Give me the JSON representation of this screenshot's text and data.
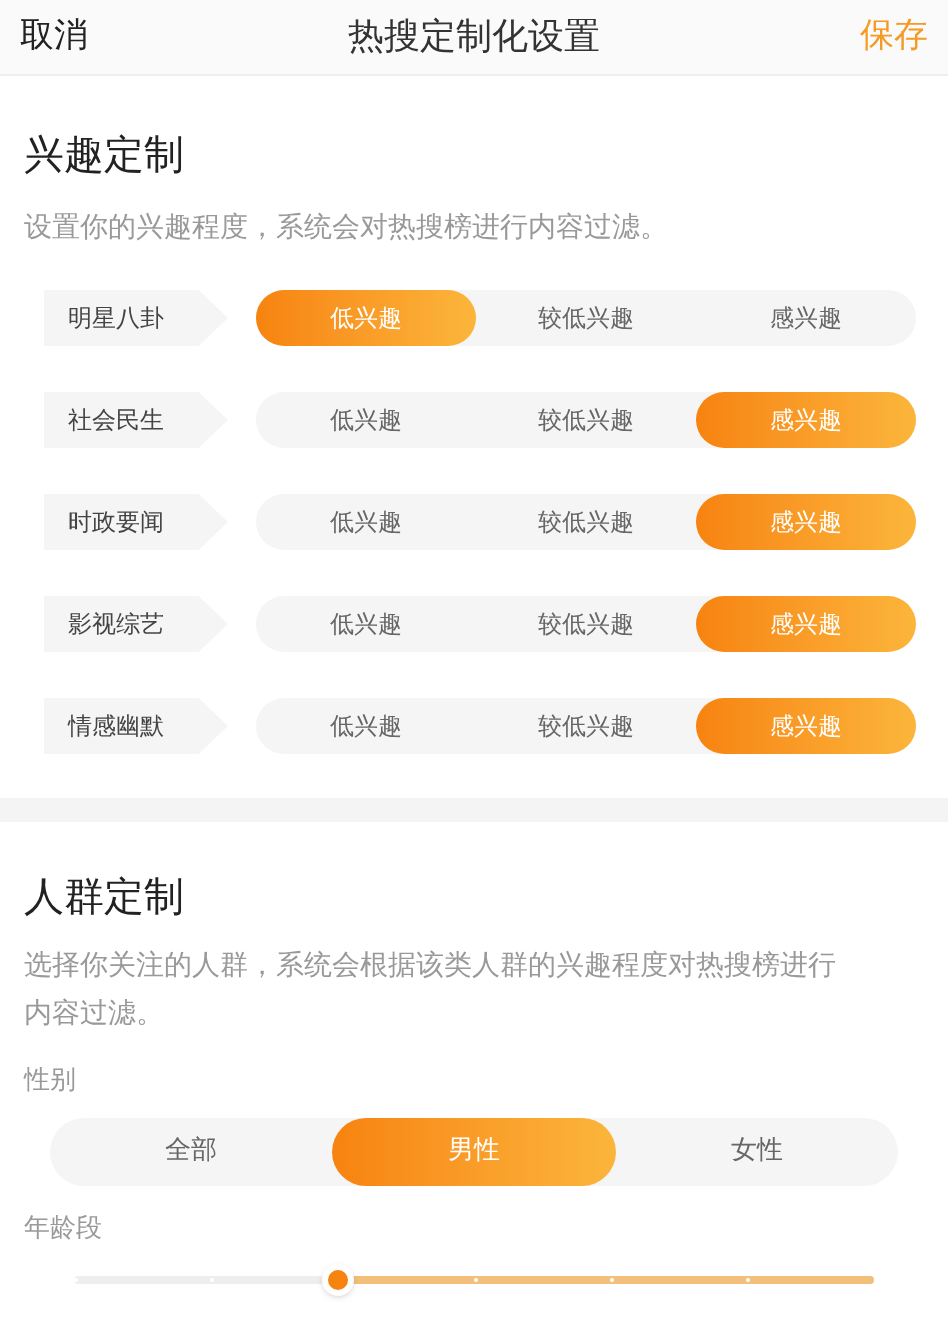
{
  "header": {
    "cancel": "取消",
    "title": "热搜定制化设置",
    "save": "保存"
  },
  "interest": {
    "title": "兴趣定制",
    "description": "设置你的兴趣程度，系统会对热搜榜进行内容过滤。",
    "rows": [
      {
        "label": "明星八卦",
        "options": [
          {
            "label": "低兴趣",
            "selected": true
          },
          {
            "label": "较低兴趣",
            "selected": false
          },
          {
            "label": "感兴趣",
            "selected": false
          }
        ]
      },
      {
        "label": "社会民生",
        "options": [
          {
            "label": "低兴趣",
            "selected": false
          },
          {
            "label": "较低兴趣",
            "selected": false
          },
          {
            "label": "感兴趣",
            "selected": true
          }
        ]
      },
      {
        "label": "时政要闻",
        "options": [
          {
            "label": "低兴趣",
            "selected": false
          },
          {
            "label": "较低兴趣",
            "selected": false
          },
          {
            "label": "感兴趣",
            "selected": true
          }
        ]
      },
      {
        "label": "影视综艺",
        "options": [
          {
            "label": "低兴趣",
            "selected": false
          },
          {
            "label": "较低兴趣",
            "selected": false
          },
          {
            "label": "感兴趣",
            "selected": true
          }
        ]
      },
      {
        "label": "情感幽默",
        "options": [
          {
            "label": "低兴趣",
            "selected": false
          },
          {
            "label": "较低兴趣",
            "selected": false
          },
          {
            "label": "感兴趣",
            "selected": true
          }
        ]
      }
    ]
  },
  "crowd": {
    "title": "人群定制",
    "description": "选择你关注的人群，系统会根据该类人群的兴趣程度对热搜榜进行内容过滤。",
    "gender": {
      "label": "性别",
      "options": [
        {
          "label": "全部",
          "selected": false
        },
        {
          "label": "男性",
          "selected": true
        },
        {
          "label": "女性",
          "selected": false
        }
      ]
    },
    "age": {
      "label": "年龄段"
    }
  }
}
